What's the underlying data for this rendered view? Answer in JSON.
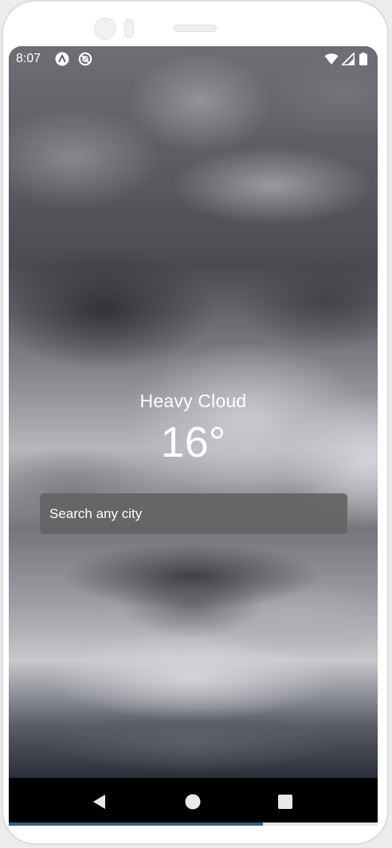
{
  "statusbar": {
    "time": "8:07",
    "left_icons": [
      "android-auto-icon",
      "no-disturb-icon"
    ],
    "right_icons": [
      "wifi-icon",
      "signal-icon",
      "battery-icon"
    ]
  },
  "weather": {
    "condition": "Heavy Cloud",
    "temperature": "16°"
  },
  "search": {
    "placeholder": "Search any city",
    "value": ""
  },
  "navbar": {
    "buttons": [
      "back-icon",
      "home-icon",
      "recents-icon"
    ]
  },
  "colors": {
    "text": "#ffffff",
    "search_bg": "#646464",
    "navbar_bg": "#000000",
    "progress_accent": "#3f5f7a"
  },
  "progress": {
    "fraction": 0.69
  }
}
